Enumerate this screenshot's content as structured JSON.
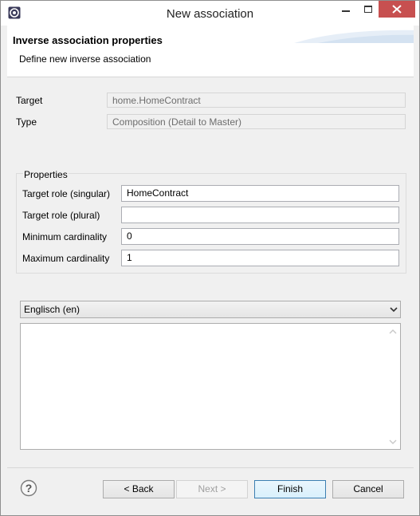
{
  "window": {
    "title": "New association"
  },
  "header": {
    "title": "Inverse association properties",
    "description": "Define new inverse association"
  },
  "info": {
    "target_label": "Target",
    "target_value": "home.HomeContract",
    "type_label": "Type",
    "type_value": "Composition (Detail to Master)"
  },
  "properties": {
    "group_title": "Properties",
    "fields": [
      {
        "label": "Target role (singular)",
        "value": "HomeContract"
      },
      {
        "label": "Target role (plural)",
        "value": ""
      },
      {
        "label": "Minimum cardinality",
        "value": "0"
      },
      {
        "label": "Maximum cardinality",
        "value": "1"
      }
    ]
  },
  "language": {
    "selected": "Englisch (en)",
    "description_text": ""
  },
  "buttons": {
    "back": "< Back",
    "next": "Next >",
    "finish": "Finish",
    "cancel": "Cancel"
  },
  "icons": {
    "app": "eclipse-app-icon",
    "minimize": "minimize-icon",
    "maximize": "maximize-icon",
    "close": "close-icon",
    "help": "help-icon",
    "dropdown": "chevron-down-icon"
  },
  "colors": {
    "close_button": "#c75050",
    "default_button_border": "#3c7fb1"
  }
}
